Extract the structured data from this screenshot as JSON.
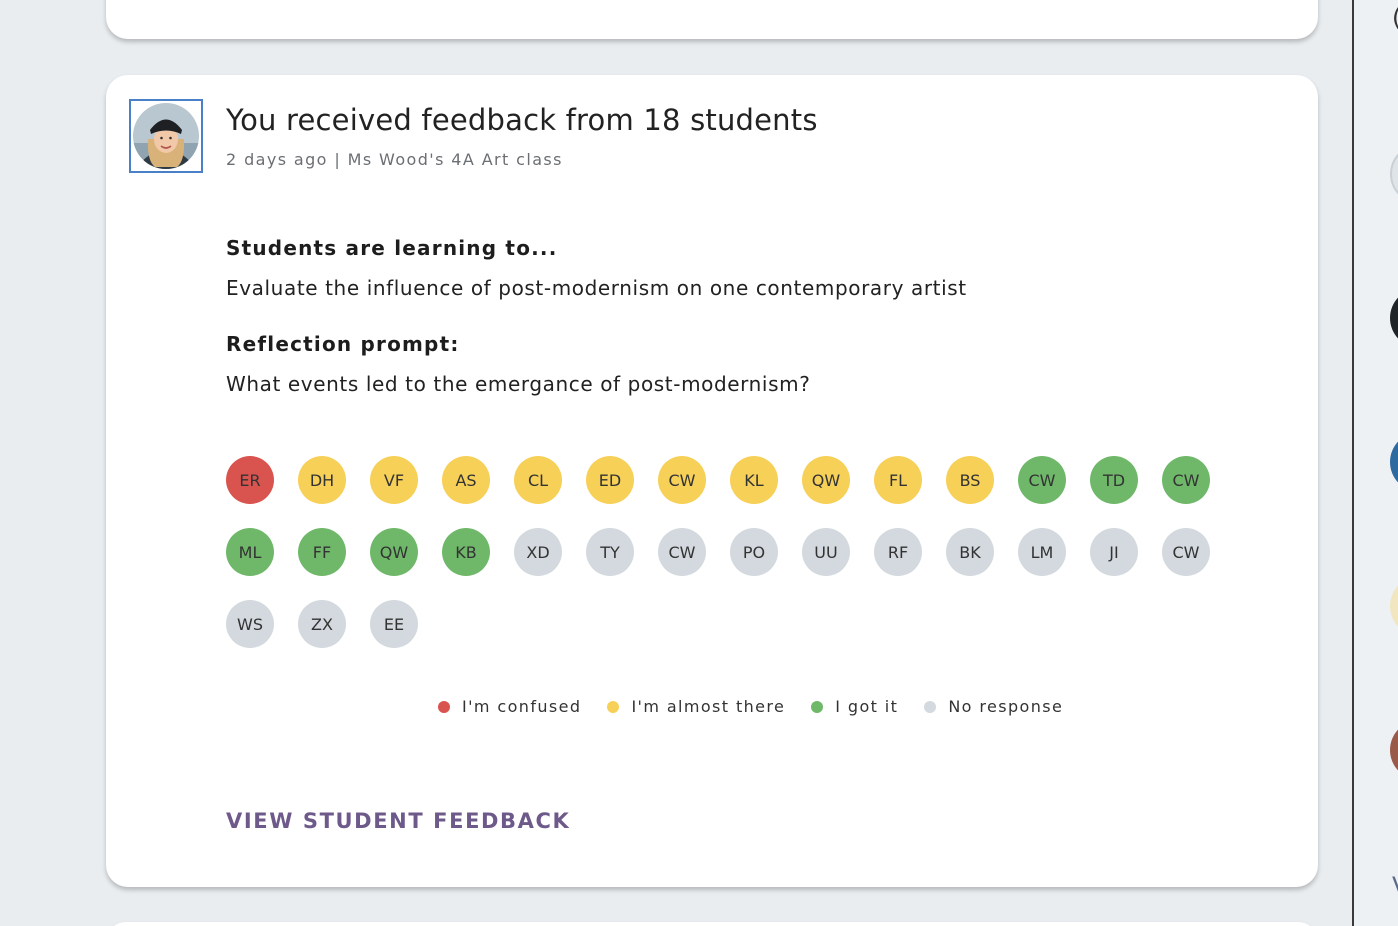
{
  "feed": {
    "card": {
      "title": "You received feedback from 18 students",
      "subtitle": "2 days ago | Ms Wood's 4A Art class",
      "learning_heading": "Students are learning to...",
      "learning_text": "Evaluate the influence of post-modernism on one contemporary artist",
      "prompt_heading": "Reflection prompt:",
      "prompt_text": "What events led to the emergance of post-modernism?",
      "students": [
        {
          "initials": "ER",
          "status": "confused"
        },
        {
          "initials": "DH",
          "status": "almost"
        },
        {
          "initials": "VF",
          "status": "almost"
        },
        {
          "initials": "AS",
          "status": "almost"
        },
        {
          "initials": "CL",
          "status": "almost"
        },
        {
          "initials": "ED",
          "status": "almost"
        },
        {
          "initials": "CW",
          "status": "almost"
        },
        {
          "initials": "KL",
          "status": "almost"
        },
        {
          "initials": "QW",
          "status": "almost"
        },
        {
          "initials": "FL",
          "status": "almost"
        },
        {
          "initials": "BS",
          "status": "almost"
        },
        {
          "initials": "CW",
          "status": "got"
        },
        {
          "initials": "TD",
          "status": "got"
        },
        {
          "initials": "CW",
          "status": "got"
        },
        {
          "initials": "ML",
          "status": "got"
        },
        {
          "initials": "FF",
          "status": "got"
        },
        {
          "initials": "QW",
          "status": "got"
        },
        {
          "initials": "KB",
          "status": "got"
        },
        {
          "initials": "XD",
          "status": "none"
        },
        {
          "initials": "TY",
          "status": "none"
        },
        {
          "initials": "CW",
          "status": "none"
        },
        {
          "initials": "PO",
          "status": "none"
        },
        {
          "initials": "UU",
          "status": "none"
        },
        {
          "initials": "RF",
          "status": "none"
        },
        {
          "initials": "BK",
          "status": "none"
        },
        {
          "initials": "LM",
          "status": "none"
        },
        {
          "initials": "JI",
          "status": "none"
        },
        {
          "initials": "CW",
          "status": "none"
        },
        {
          "initials": "WS",
          "status": "none"
        },
        {
          "initials": "ZX",
          "status": "none"
        },
        {
          "initials": "EE",
          "status": "none"
        }
      ],
      "legend": [
        {
          "key": "confused",
          "label": "I'm confused"
        },
        {
          "key": "almost",
          "label": "I'm almost there"
        },
        {
          "key": "got",
          "label": "I got it"
        },
        {
          "key": "none",
          "label": "No response"
        }
      ],
      "cta_label": "VIEW STUDENT FEEDBACK"
    }
  },
  "colors": {
    "confused": "#d9534f",
    "almost": "#f7d058",
    "got": "#6fb869",
    "none": "#d3d9de",
    "cta": "#6e5a8a",
    "avatar_border": "#4a80c8"
  },
  "icons": {
    "avatar": "teacher-avatar-icon"
  }
}
